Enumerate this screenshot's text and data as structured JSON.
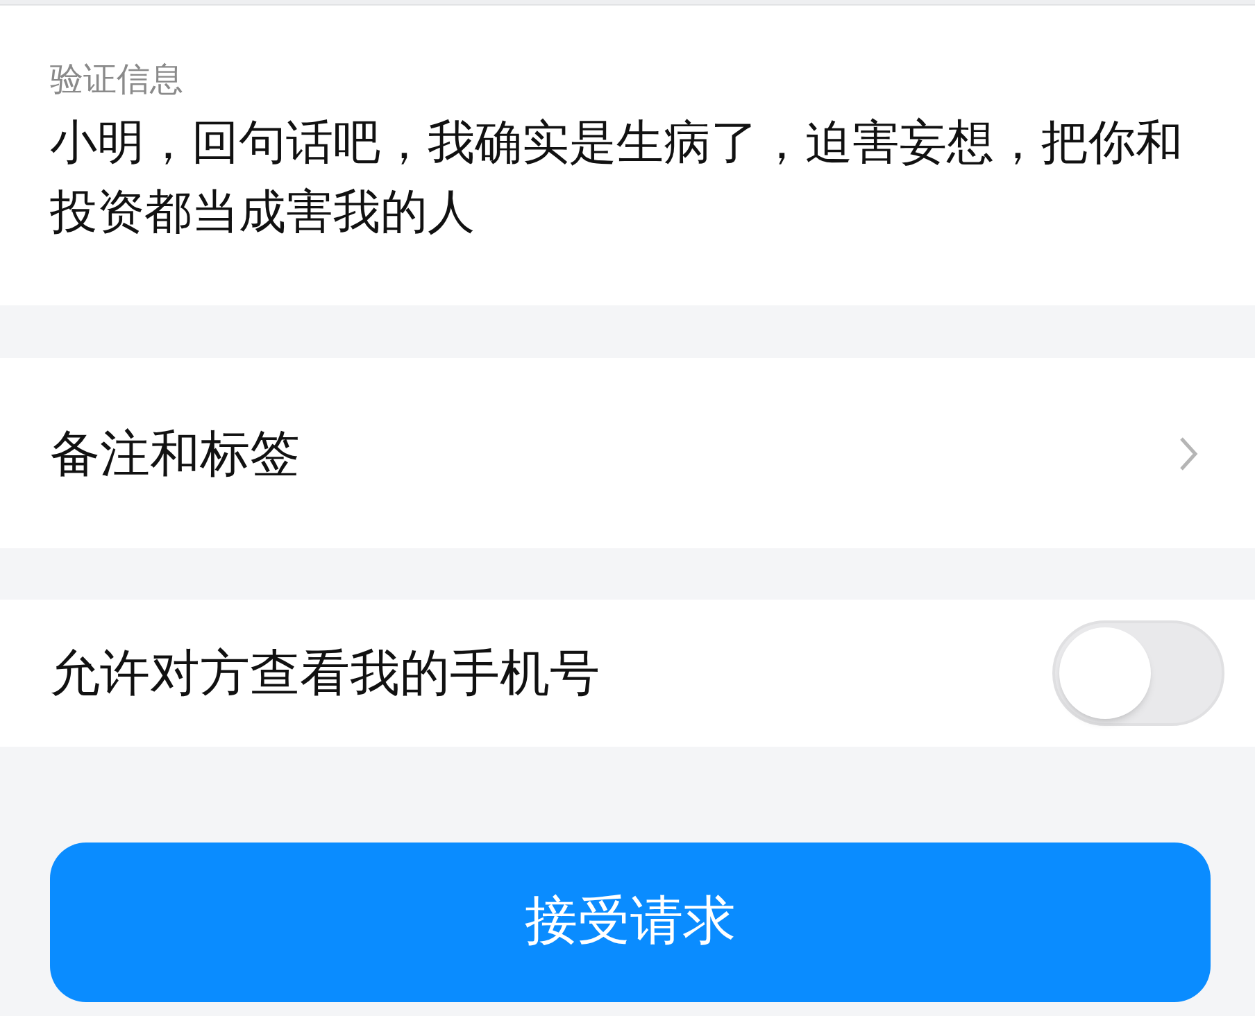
{
  "verification": {
    "label": "验证信息",
    "message": "小明，回句话吧，我确实是生病了，迫害妄想，把你和投资都当成害我的人"
  },
  "remark_row": {
    "label": "备注和标签"
  },
  "phone_row": {
    "label": "允许对方查看我的手机号",
    "on": false
  },
  "accept_button": {
    "label": "接受请求"
  }
}
